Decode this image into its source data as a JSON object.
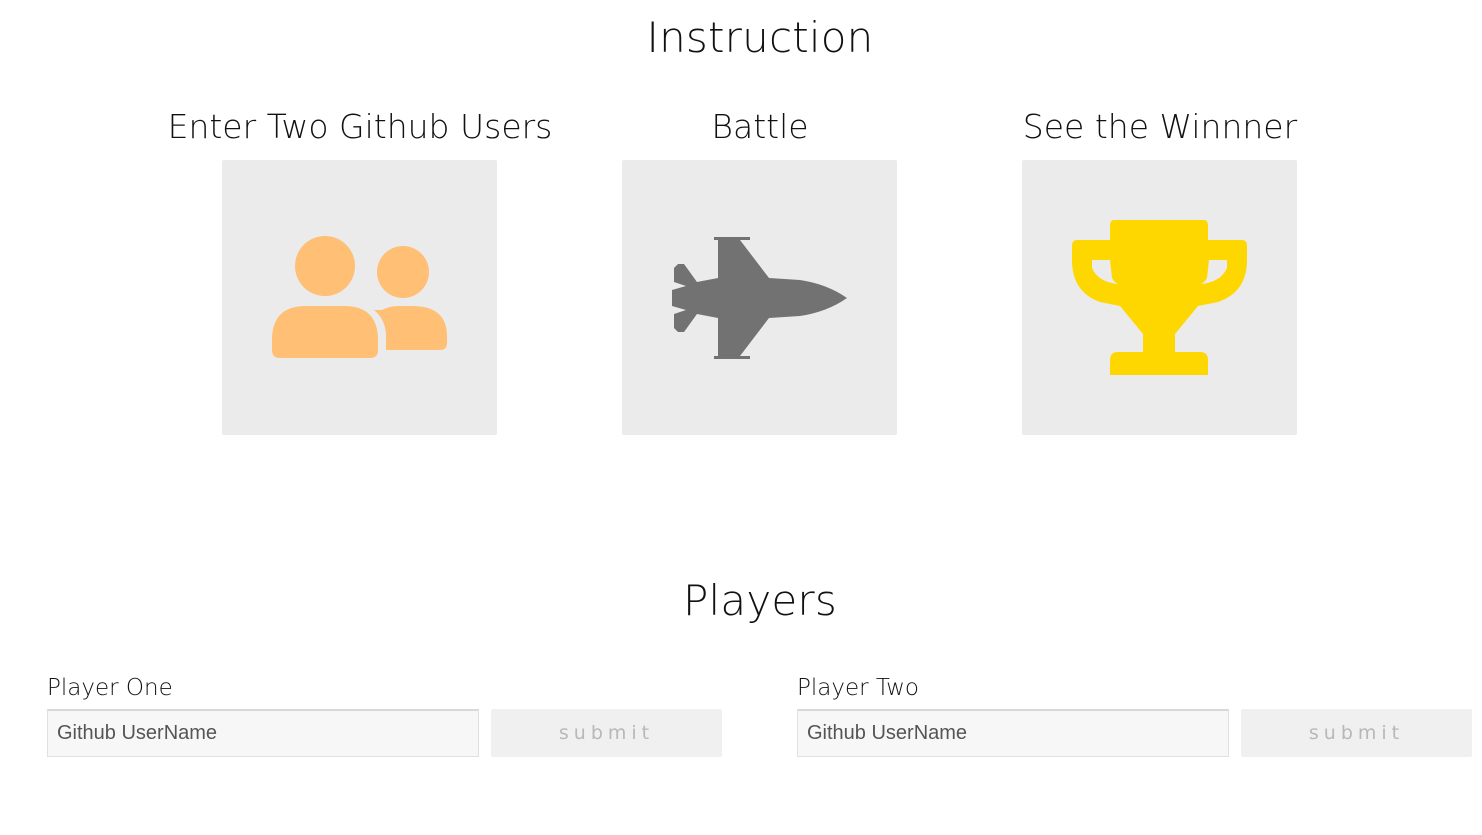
{
  "instruction": {
    "title": "Instruction",
    "steps": [
      {
        "label": "Enter Two Github Users",
        "icon": "users-icon",
        "color": "#ffbf74"
      },
      {
        "label": "Battle",
        "icon": "fighter-jet-icon",
        "color": "#727272"
      },
      {
        "label": "See the Winnner",
        "icon": "trophy-icon",
        "color": "#ffd700"
      }
    ]
  },
  "players": {
    "title": "Players",
    "items": [
      {
        "label": "Player One",
        "placeholder": "Github UserName",
        "submit_label": "submit"
      },
      {
        "label": "Player Two",
        "placeholder": "Github UserName",
        "submit_label": "submit"
      }
    ]
  },
  "colors": {
    "tile_background": "#ebebeb",
    "button_background": "#f0f0f0",
    "button_text": "#b8b8b8"
  }
}
